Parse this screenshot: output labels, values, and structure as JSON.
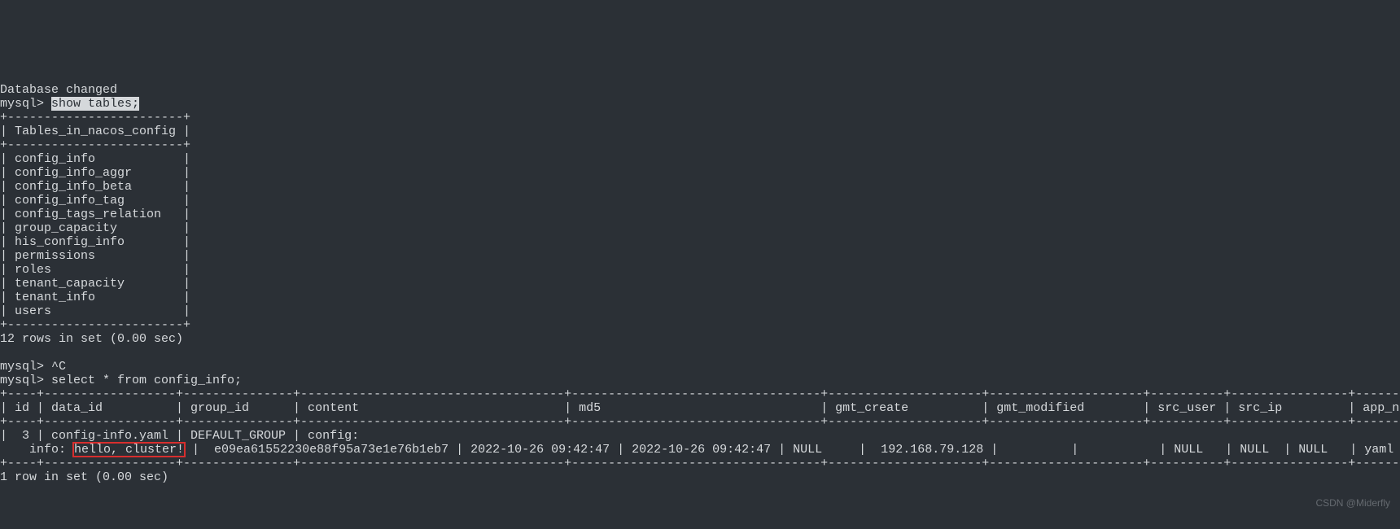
{
  "status_line": "Database changed",
  "prompt": "mysql> ",
  "cmd_show_tables": "show tables;",
  "show_tables_output": {
    "top_rule": "+------------------------+",
    "header_line": "| Tables_in_nacos_config |",
    "mid_rule": "+------------------------+",
    "rows": [
      "| config_info            |",
      "| config_info_aggr       |",
      "| config_info_beta       |",
      "| config_info_tag        |",
      "| config_tags_relation   |",
      "| group_capacity         |",
      "| his_config_info        |",
      "| permissions            |",
      "| roles                  |",
      "| tenant_capacity        |",
      "| tenant_info            |",
      "| users                  |"
    ],
    "bot_rule": "+------------------------+",
    "summary": "12 rows in set (0.00 sec)"
  },
  "ctrl_c_line": "mysql> ^C",
  "cmd_select": "mysql> select * from config_info;",
  "select_output": {
    "rule": "+----+------------------+---------------+------------------------------------+----------------------------------+---------------------+---------------------+----------+----------------+----------+----------+--------+---------+--------+------+----------+",
    "header": "| id | data_id          | group_id      | content                            | md5                              | gmt_create          | gmt_modified        | src_user | src_ip         | app_name | tenant_id | c_desc | c_use | effect | type | c_schema |",
    "data_pre": "|  3 | config-info.yaml | DEFAULT_GROUP | config:\n    info: ",
    "data_hl": "hello, cluster!",
    "data_post": " |  e09ea61552230e88f95a73e1e76b1eb7 | 2022-10-26 09:42:47 | 2022-10-26 09:42:47 | NULL     |  192.168.79.128 |          |           | NULL   | NULL  | NULL   | yaml | NULL     |",
    "summary": "1 row in set (0.00 sec)"
  },
  "watermark": "CSDN @Miderfly"
}
